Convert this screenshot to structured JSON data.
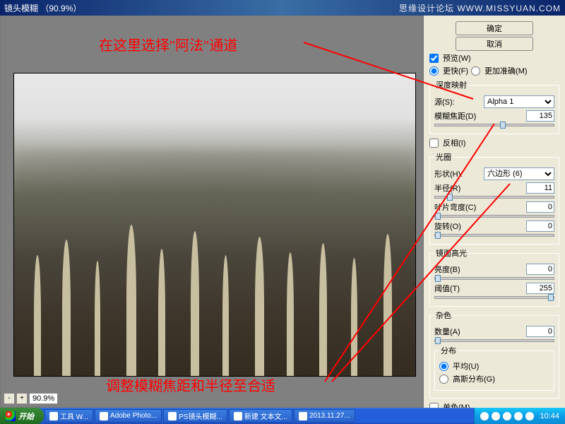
{
  "titlebar": {
    "title": "镜头模糊 （90.9%）",
    "watermark": "思缘设计论坛  WWW.MISSYUAN.COM"
  },
  "preview": {
    "zoom_minus": "-",
    "zoom_plus": "+",
    "zoom_value": "90.9%"
  },
  "panel": {
    "ok": "确定",
    "cancel": "取消",
    "preview": "预览(W)",
    "faster": "更快(F)",
    "more_accurate": "更加准确(M)",
    "depth_map": {
      "legend": "深度映射",
      "source_label": "源(S):",
      "source_value": "Alpha 1",
      "focal_label": "模糊焦距(D)",
      "focal_value": "135"
    },
    "invert": "反相(I)",
    "iris": {
      "legend": "光圈",
      "shape_label": "形状(H):",
      "shape_value": "六边形 (6)",
      "radius_label": "半径(R)",
      "radius_value": "11",
      "curvature_label": "叶片弯度(C)",
      "curvature_value": "0",
      "rotation_label": "旋转(O)",
      "rotation_value": "0"
    },
    "specular": {
      "legend": "镜面高光",
      "brightness_label": "亮度(B)",
      "brightness_value": "0",
      "threshold_label": "阈值(T)",
      "threshold_value": "255"
    },
    "noise": {
      "legend": "杂色",
      "amount_label": "数量(A)",
      "amount_value": "0",
      "dist_legend": "分布",
      "uniform": "平均(U)",
      "gaussian": "高斯分布(G)"
    },
    "mono": "单色(M)"
  },
  "annotations": {
    "top": "在这里选择\"阿法\"通道",
    "bottom": "调整模糊焦距和半径至合适"
  },
  "taskbar": {
    "start": "开始",
    "items": [
      "工具  W...",
      "Adobe Photo...",
      "PS镜头模糊...",
      "新建 文本文...",
      "2013.11.27..."
    ],
    "clock": "10:44"
  }
}
